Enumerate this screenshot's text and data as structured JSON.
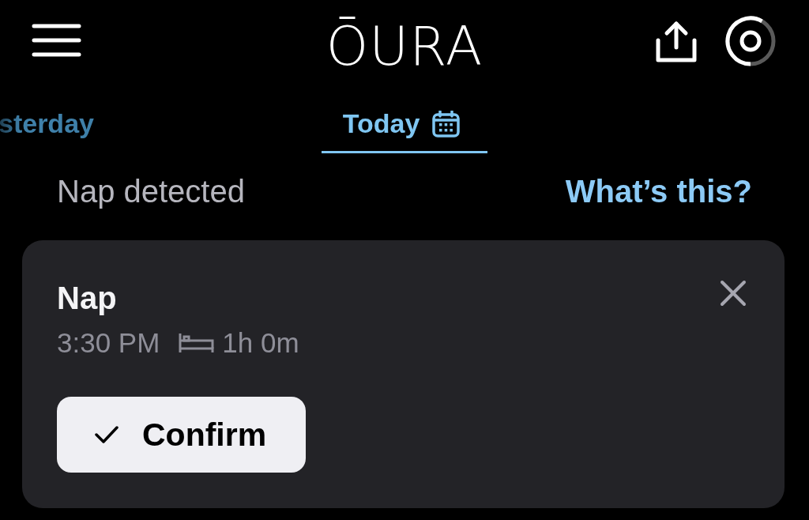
{
  "header": {
    "logo": "ŌURA"
  },
  "tabs": [
    {
      "label": "sterday",
      "selected": false
    },
    {
      "label": "Today",
      "selected": true
    }
  ],
  "section": {
    "title": "Nap detected",
    "link": "What’s this?"
  },
  "card": {
    "title": "Nap",
    "time": "3:30 PM",
    "duration": "1h 0m",
    "confirm_button": "Confirm"
  }
}
